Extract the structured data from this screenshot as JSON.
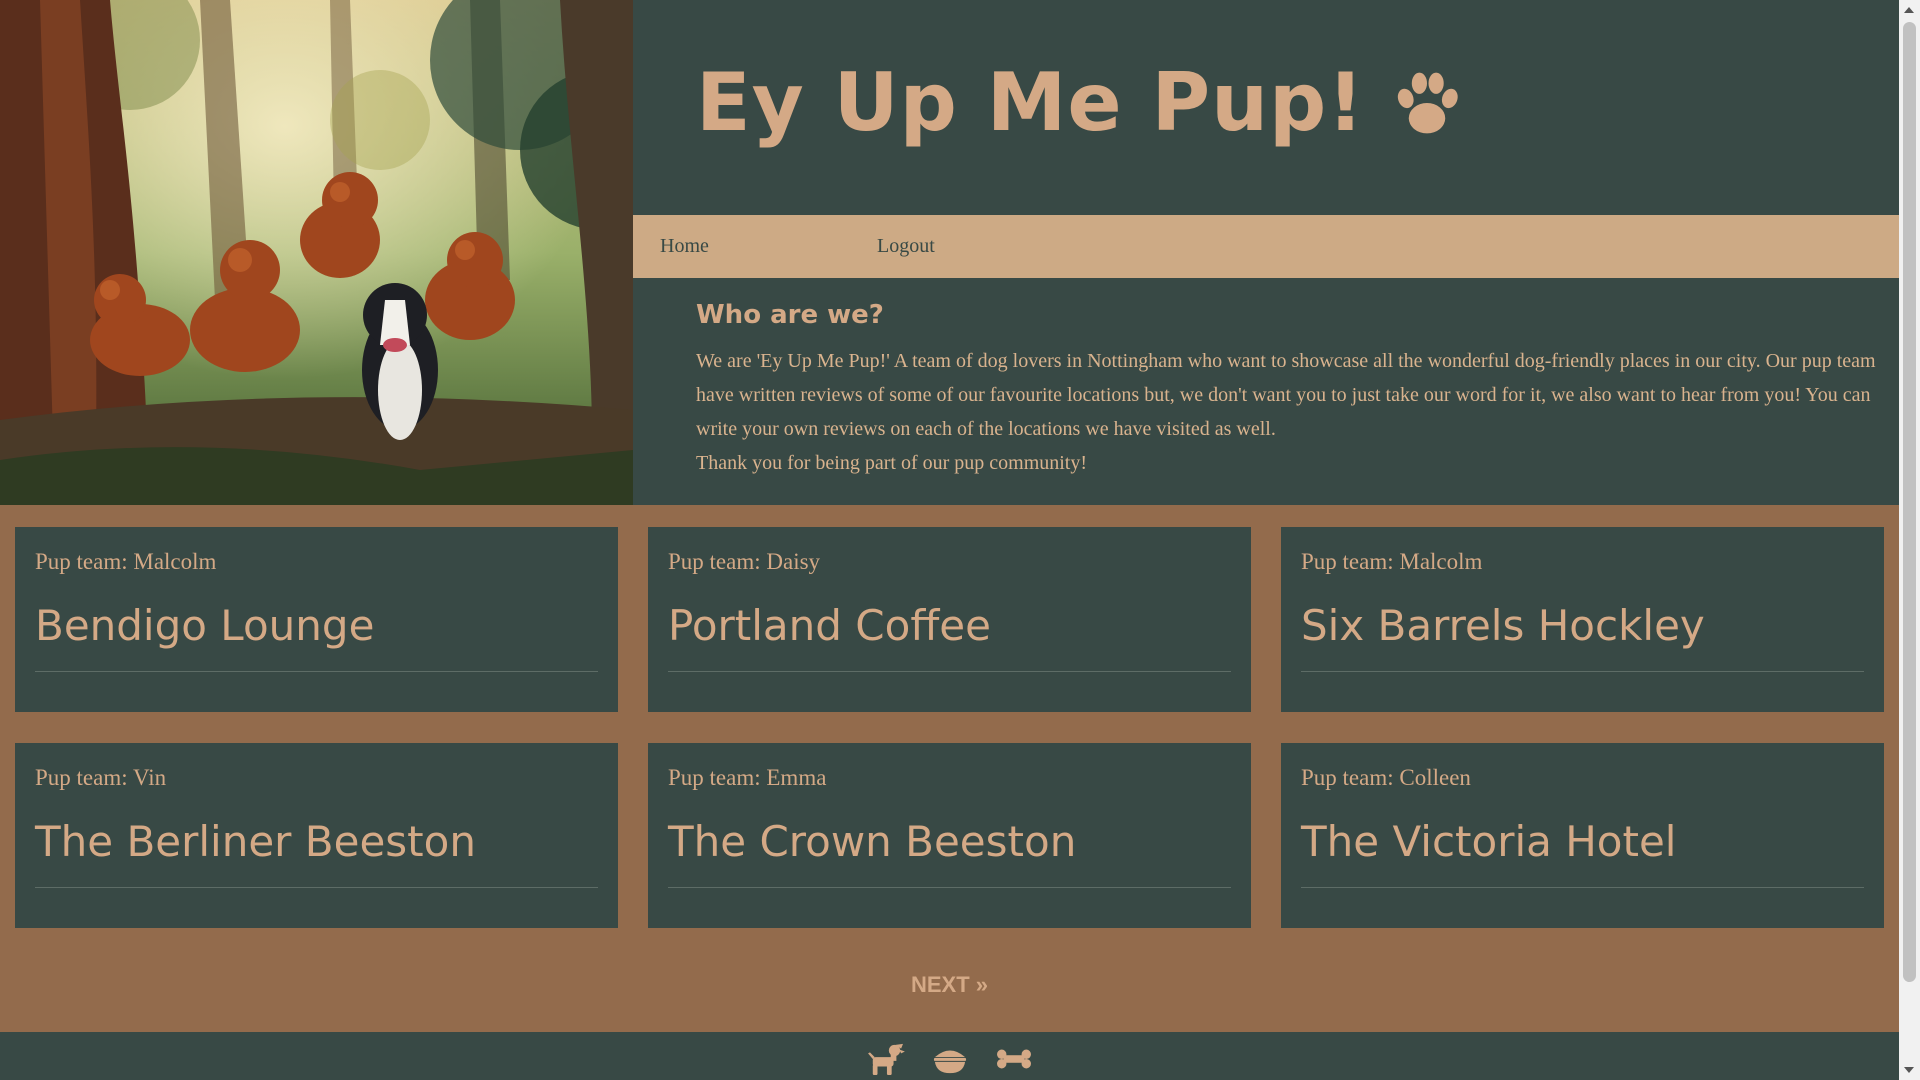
{
  "site": {
    "brand": "Ey Up Me Pup!",
    "brand_icon": "paw-icon",
    "hero_image": "painting of dogs running through a forest"
  },
  "nav": {
    "items": [
      {
        "label": "Home"
      },
      {
        "label": "Logout"
      }
    ]
  },
  "about": {
    "heading": "Who are we?",
    "paragraphs": [
      "We are 'Ey Up Me Pup!' A team of dog lovers in Nottingham who want to showcase all the wonderful dog-friendly places in our city. Our pup team have written reviews of some of our favourite locations but, we don't want you to just take our word for it, we also want to hear from you! You can write your own reviews on each of the locations we have visited as well.",
      "Thank you for being part of our pup community!"
    ]
  },
  "cards": [
    {
      "author": "Pup team: Malcolm",
      "venue": "Bendigo Lounge"
    },
    {
      "author": "Pup team: Daisy",
      "venue": "Portland Coffee"
    },
    {
      "author": "Pup team: Malcolm",
      "venue": "Six Barrels Hockley"
    },
    {
      "author": "Pup team: Vin",
      "venue": "The Berliner Beeston"
    },
    {
      "author": "Pup team: Emma",
      "venue": "The Crown Beeston"
    },
    {
      "author": "Pup team: Colleen",
      "venue": "The Victoria Hotel"
    }
  ],
  "pagination": {
    "next_label": "NEXT »"
  },
  "footer": {
    "icons": [
      "dog-icon",
      "food-bowl-icon",
      "bone-icon"
    ]
  },
  "colors": {
    "dark_green": "#384945",
    "tan": "#cdaa85",
    "brown": "#936b4c",
    "text_tan": "#d4a986"
  }
}
